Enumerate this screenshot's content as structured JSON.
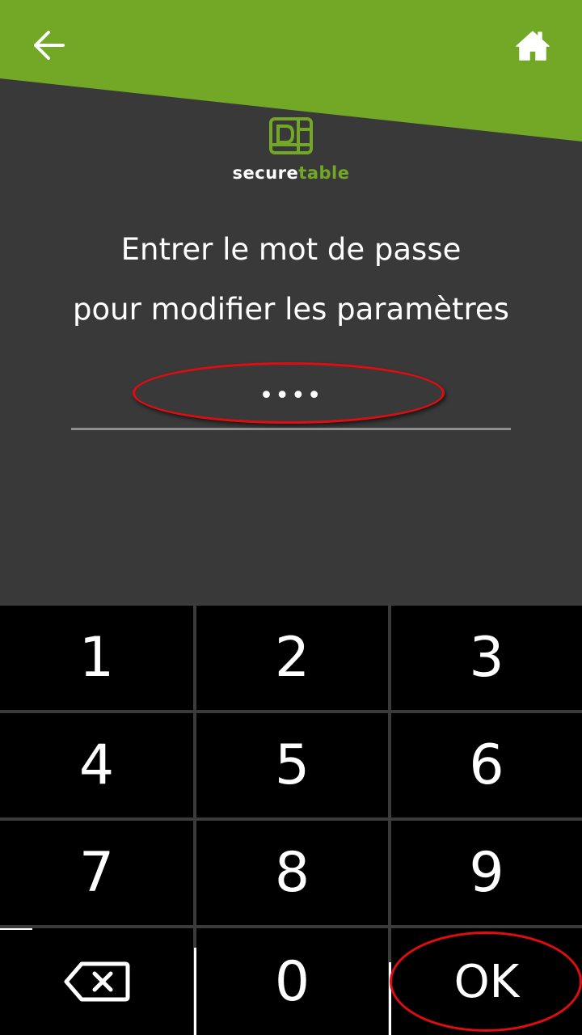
{
  "header": {
    "back_icon": "arrow-left-icon",
    "home_icon": "home-icon",
    "accent_color": "#72a825"
  },
  "logo": {
    "part1": "secure",
    "part2": "table"
  },
  "prompt": {
    "line1": "Entrer le mot de passe",
    "line2": "pour modifier les paramètres"
  },
  "password": {
    "value": "••••"
  },
  "keypad": {
    "k1": "1",
    "k2": "2",
    "k3": "3",
    "k4": "4",
    "k5": "5",
    "k6": "6",
    "k7": "7",
    "k8": "8",
    "k9": "9",
    "backspace_icon": "backspace-icon",
    "k0": "0",
    "ok": "OK"
  },
  "annotations": {
    "color": "#e00c10"
  }
}
